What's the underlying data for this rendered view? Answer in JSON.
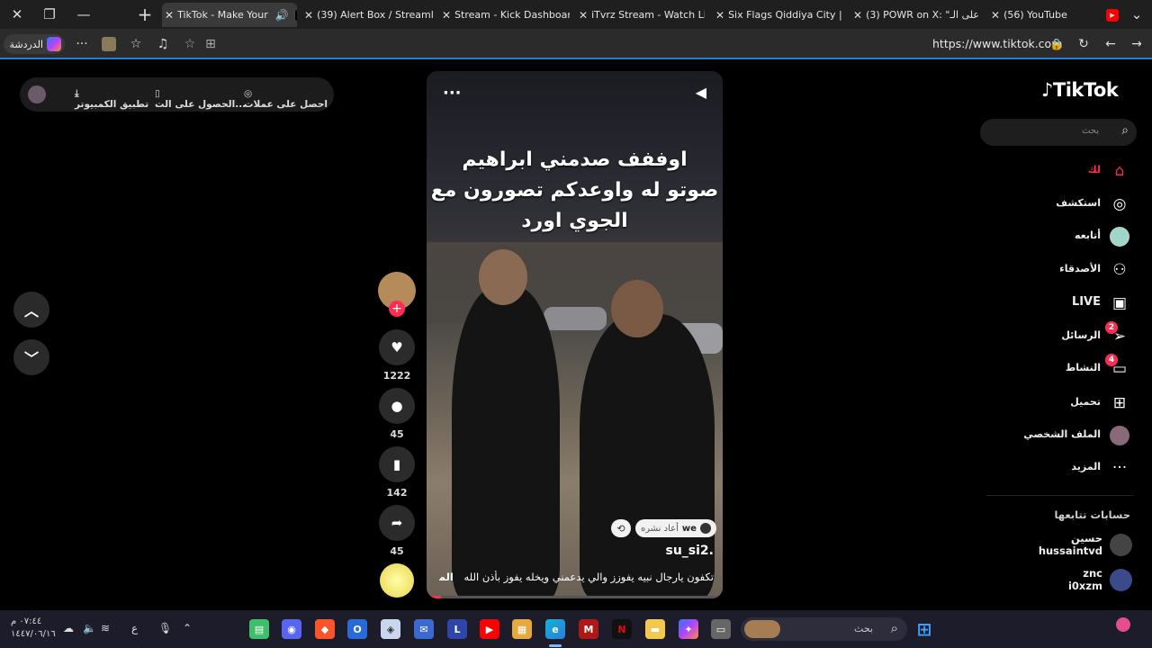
{
  "browser": {
    "tabs": [
      {
        "label": "TikTok - Make Your",
        "active": true,
        "icon": "tiktok"
      },
      {
        "label": "(39) Alert Box / Streaml",
        "icon": "streamlabs"
      },
      {
        "label": "Stream - Kick Dashboard",
        "icon": "kick"
      },
      {
        "label": "iTvrz Stream - Watch Liv",
        "icon": "kick"
      },
      {
        "label": "Six Flags Qiddiya City |",
        "icon": "sixflags"
      },
      {
        "label": "(3) POWR on X: \"على الـ",
        "icon": "x"
      },
      {
        "label": "(56) YouTube",
        "icon": "youtube"
      }
    ],
    "url": "https://www.tiktok.com",
    "copilot_label": "الدردشة"
  },
  "promo": {
    "coins": "احصل على عملات",
    "get_app": "الحصول على الت...",
    "desktop_app": "تطبيق الكمبيوتر"
  },
  "video": {
    "caption": [
      "اوففف صدمني ابراهيم",
      "صوتو له واوعدكم تصورون مع",
      "الجوي اورد"
    ],
    "username": "su_si2.",
    "description": "تكفون يارجال نبيه يفوزز والي يدعمني ويخله يفوز بأذن الله",
    "more": "المزيد",
    "repost_text": "أعاد نشره",
    "repost_user": "we",
    "progress": 0.05
  },
  "actions": {
    "likes": "1222",
    "comments": "45",
    "saves": "142",
    "shares": "45"
  },
  "sidebar": {
    "logo": "TikTok",
    "search_placeholder": "بحث",
    "items": [
      {
        "label": "لك",
        "icon": "home-icon",
        "active": true
      },
      {
        "label": "استكشف",
        "icon": "compass-icon"
      },
      {
        "label": "أتابعه",
        "icon": "following-avatar"
      },
      {
        "label": "الأصدقاء",
        "icon": "friends-icon"
      },
      {
        "label": "LIVE",
        "icon": "live-icon"
      },
      {
        "label": "الرسائل",
        "icon": "messages-icon",
        "badge": "2"
      },
      {
        "label": "النشاط",
        "icon": "activity-icon",
        "badge": "4"
      },
      {
        "label": "تحميل",
        "icon": "upload-icon"
      },
      {
        "label": "الملف الشخصي",
        "icon": "profile-avatar"
      },
      {
        "label": "المزيد",
        "icon": "more-icon"
      }
    ],
    "following_title": "حسابات تتابعها",
    "accounts": [
      {
        "name": "حسين",
        "handle": "hussaintvd"
      },
      {
        "name": "znc",
        "handle": "i0xzm"
      }
    ]
  },
  "taskbar": {
    "search_label": "بحث",
    "time": "٠٧:٤٤ م",
    "date": "١٤٤٧/٠٦/١٦",
    "lang": "ع"
  },
  "colors": {
    "accent": "#fe2c55",
    "edge_blue": "#2a7ad0"
  }
}
